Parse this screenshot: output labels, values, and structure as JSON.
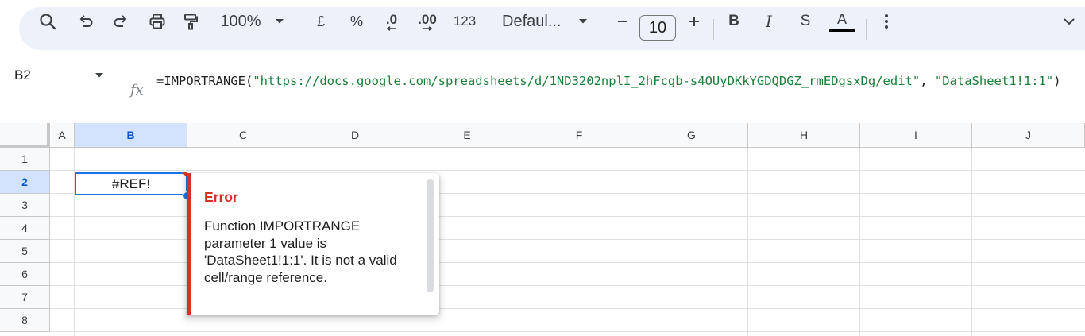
{
  "toolbar": {
    "zoom": "100%",
    "currency_label": "£",
    "percent_label": "%",
    "decrease_decimal_label": ".0",
    "increase_decimal_label": ".00",
    "number_format_label": "123",
    "font_family": "Defaul...",
    "font_size": "10",
    "bold_label": "B",
    "italic_label": "I",
    "strike_label": "S",
    "text_color_label": "A"
  },
  "formula_bar": {
    "name_box": "B2",
    "fx_label": "fx",
    "formula_prefix": "=IMPORTRANGE(",
    "formula_arg1": "\"https://docs.google.com/spreadsheets/d/1ND3202nplI_2hFcgb-s4OUyDKkYGDQDGZ_rmEDgsxDg/edit\"",
    "formula_sep": ", ",
    "formula_arg2": "\"DataSheet1!1:1\"",
    "formula_suffix": ")"
  },
  "grid": {
    "columns": [
      "A",
      "B",
      "C",
      "D",
      "E",
      "F",
      "G",
      "H",
      "I",
      "J"
    ],
    "rows": [
      "1",
      "2",
      "3",
      "4",
      "5",
      "6",
      "7",
      "8"
    ],
    "selected_cell_value": "#REF!"
  },
  "error_popup": {
    "title": "Error",
    "message": "Function IMPORTRANGE parameter 1 value is 'DataSheet1!1:1'. It is not a valid cell/range reference."
  },
  "colors": {
    "accent": "#1a73e8",
    "error": "#d93025",
    "toolbar_bg": "#edf2fa",
    "formula_string": "#188038"
  }
}
